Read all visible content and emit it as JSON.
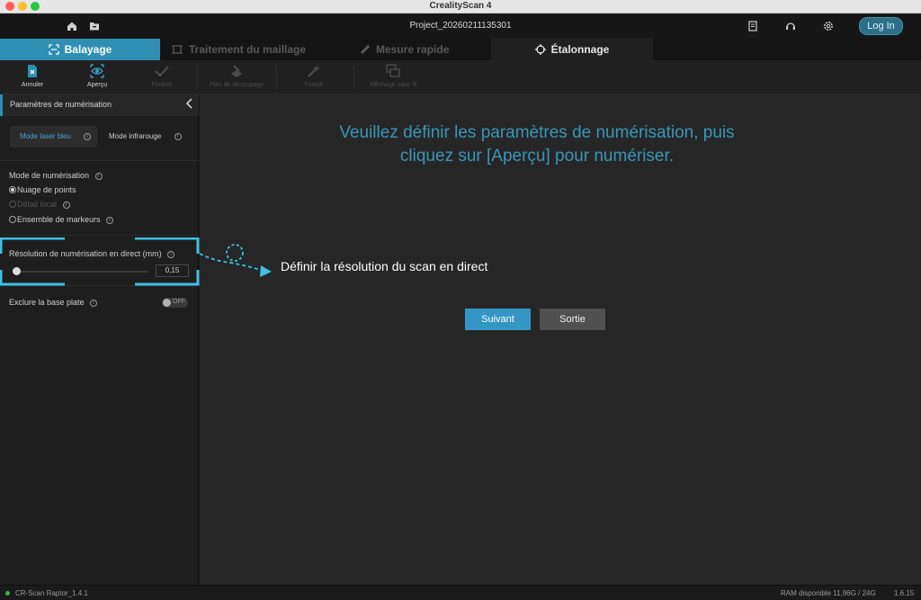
{
  "window": {
    "title": "CrealityScan 4"
  },
  "header": {
    "project": "Project_20260211135301",
    "login": "Log In",
    "icons": [
      "home-icon",
      "folder-icon",
      "notes-icon",
      "support-icon",
      "settings-icon"
    ]
  },
  "tabs": [
    {
      "label": "Balayage",
      "icon": "scan-frame-icon"
    },
    {
      "label": "Traitement du maillage",
      "icon": "mesh-icon"
    },
    {
      "label": "Mesure rapide",
      "icon": "ruler-icon"
    },
    {
      "label": "Étalonnage",
      "icon": "crosshair-icon"
    }
  ],
  "toolbar": {
    "items": [
      {
        "label": "Annuler",
        "icon": "cancel-file-icon",
        "enabled": true
      },
      {
        "label": "Aperçu",
        "icon": "preview-eye-icon",
        "enabled": true
      },
      {
        "label": "Finition",
        "icon": "check-icon",
        "enabled": false
      },
      {
        "label": "Plan de découpage",
        "icon": "cutting-plane-icon",
        "enabled": false
      },
      {
        "label": "Fusion",
        "icon": "fusion-wand-icon",
        "enabled": false
      },
      {
        "label": "Affichage sans fil",
        "icon": "wireless-display-icon",
        "enabled": false
      }
    ]
  },
  "sidebar": {
    "title": "Paramètres de numérisation",
    "modes": {
      "blue": "Mode laser bleu",
      "infrared": "Mode infrarouge"
    },
    "scan_mode": {
      "label": "Mode de numérisation",
      "options": [
        {
          "label": "Nuage de points",
          "selected": true,
          "enabled": true
        },
        {
          "label": "Détail local",
          "selected": false,
          "enabled": false
        },
        {
          "label": "Ensemble de markeurs",
          "selected": false,
          "enabled": true
        }
      ]
    },
    "resolution": {
      "label": "Résolution de numérisation en direct (mm)",
      "value": "0,15"
    },
    "exclude_base": {
      "label": "Exclure la base plate",
      "toggle": "OFF"
    }
  },
  "main": {
    "prompt": "Veuillez définir les paramètres de numérisation, puis cliquez sur [Aperçu] pour numériser.",
    "hint": "Définir la résolution du scan en direct",
    "next": "Suivant",
    "exit": "Sortie"
  },
  "status": {
    "device": "CR-Scan Raptor_1.4.1",
    "ram": "RAM disponible 11,96G / 24G",
    "version": "1.6.15"
  },
  "colors": {
    "accent": "#2f8fb3",
    "prompt": "#3a97b9",
    "connected": "#3bb54a"
  }
}
